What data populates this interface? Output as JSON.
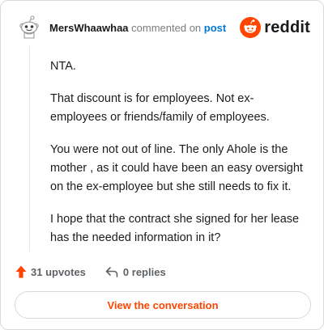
{
  "comment": {
    "username": "MersWhaawhaa",
    "action_text": "commented on",
    "post_link": "post",
    "paragraphs": [
      "NTA.",
      "That discount is for employees. Not ex-employees or friends/family of employees.",
      "You were not out of line. The only Ahole is the mother , as it could have been an easy oversight on the ex-employee but she still needs to fix it.",
      "I hope that the contract she signed for her lease has the needed information in it?"
    ]
  },
  "brand": {
    "wordmark": "reddit",
    "color": "#ff4500"
  },
  "stats": {
    "upvotes": "31 upvotes",
    "replies": "0 replies"
  },
  "cta": {
    "label": "View the conversation"
  },
  "icons": {
    "avatar": "snoo-avatar-icon",
    "brand": "reddit-logo-icon",
    "upvote": "upvote-arrow-icon",
    "reply": "reply-arrow-icon"
  }
}
